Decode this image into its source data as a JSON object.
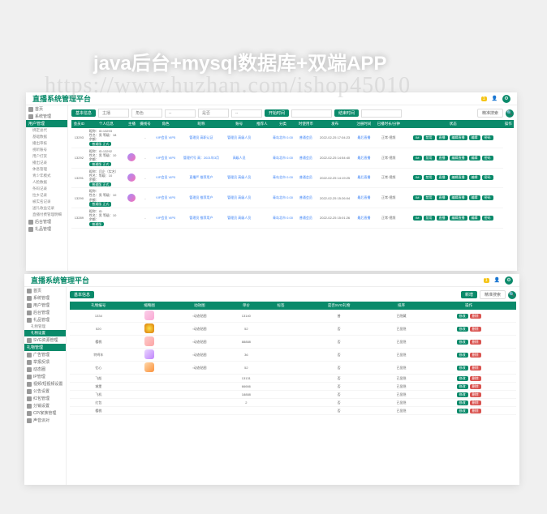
{
  "watermark": {
    "title": "java后台+mysql数据库+双端APP",
    "url": "https://www.huzhan.com/ishop45010"
  },
  "panel1": {
    "title": "直播系统管理平台",
    "badge": "1",
    "sidebar_top": [
      {
        "label": "首页",
        "icon": "⊞"
      },
      {
        "label": "系统管理",
        "icon": "⚙"
      }
    ],
    "sidebar_active": "用户管理",
    "sidebar_sub": [
      "绑定总代",
      "基础数据",
      "播出审核",
      "视听账号",
      "用户打赏",
      "播出记录",
      "休息管理",
      "青少年模式",
      "人脸数据",
      "条码记录",
      "拉乡记录",
      "被实名记录",
      "送礼收益记录",
      "直播付费管理明细"
    ],
    "sidebar_bottom": [
      {
        "label": "后台管理",
        "icon": "☰"
      },
      {
        "label": "礼品管理",
        "icon": "⚑"
      }
    ],
    "filters": {
      "basic_info": "基本信息",
      "level": "主播",
      "select_opts": [
        "角色",
        "--",
        "是否",
        "--"
      ],
      "start_label": "开始时间",
      "end_label": "结束时间",
      "clear": "精准搜索",
      "search": "搜索"
    },
    "columns": [
      "会员ID",
      "个人信息",
      "主播",
      "摄线号",
      "角色",
      "昵称",
      "账号",
      "推荐人",
      "分类",
      "时使用币",
      "发布",
      "注册时间",
      "已播时长/分钟",
      "状态",
      "操作"
    ],
    "rows": [
      {
        "id": "13293",
        "info": "昵称：ID:13293\n性名：男  等级：18\n余额：",
        "anchor_tag": "普通版 正式",
        "avatar": false,
        "role": "-",
        "nick": "VIP会员 VIP5",
        "acc": "管理员 高职认证",
        "rec": "管理员 高级人员",
        "cat": "",
        "coin": "青岛北市 0.00",
        "coin2": "普通会员",
        "time": "2022-02-25 17:04:23",
        "dur": "最后直播",
        "status": "正常·视频",
        "actions": [
          "IM",
          "禁用",
          "直播",
          "编辑直播",
          "编辑",
          "密码"
        ]
      },
      {
        "id": "13292",
        "info": "昵称：ID:13292\n性名：男  等级：10\n余额：",
        "anchor_tag": "普通版 正式",
        "avatar": true,
        "role": "-",
        "nick": "VIP会员 VIP0",
        "acc": "管理代号  \n高：2021年3月",
        "rec": "高级人员",
        "cat": "",
        "coin": "青岛北市 0.00",
        "coin2": "普通会员",
        "time": "2022-02-25 14:54:40",
        "dur": "最后直播",
        "status": "正常·视频",
        "actions": [
          "IM",
          "禁用",
          "直播",
          "编辑直播",
          "编辑",
          "密码"
        ]
      },
      {
        "id": "13291",
        "info": "昵称：闫企（实名）\n性名：等级：10\n余额：",
        "anchor_tag": "普通版 正式",
        "avatar": true,
        "role": "-",
        "nick": "VIP会员 VIP0",
        "acc": "直播严 推荐用户",
        "rec": "管理员 高级人员",
        "cat": "",
        "coin": "青岛北市 0.00",
        "coin2": "普通会员",
        "time": "2022-02-25 14:19:25",
        "dur": "最后直播",
        "status": "正常·视频",
        "actions": [
          "IM",
          "禁用",
          "直播",
          "编辑直播",
          "编辑",
          "密码"
        ]
      },
      {
        "id": "13290",
        "info": "昵称：\n性名：男  等级：10\n余额：",
        "anchor_tag": "普通版 正式",
        "avatar": true,
        "role": "-",
        "nick": "VIP会员 VIP0",
        "acc": "管理员 推荐用户",
        "rec": "管理员 高级人员",
        "cat": "",
        "coin": "青岛北市 0.00",
        "coin2": "普通会员",
        "time": "2022-02-25 15:26:04",
        "dur": "最后直播",
        "status": "正常·视频",
        "actions": [
          "IM",
          "禁用",
          "直播",
          "编辑直播",
          "编辑",
          "密码"
        ]
      },
      {
        "id": "13289",
        "info": "昵称：ID\n性名：男  等级：10\n余额：",
        "anchor_tag": "普通版",
        "avatar": false,
        "role": "-",
        "nick": "VIP会员 VIP0",
        "acc": "管理员 推荐用户",
        "rec": "管理员 高级人员",
        "cat": "",
        "coin": "青岛北市 0.00",
        "coin2": "普通会员",
        "time": "2022-02-25 15:01:26",
        "dur": "最后直播",
        "status": "正常·视频",
        "actions": [
          "IM",
          "禁用",
          "直播",
          "编辑直播",
          "编辑",
          "密码"
        ]
      }
    ]
  },
  "panel2": {
    "title": "直播系统管理平台",
    "badge": "1",
    "sidebar": [
      {
        "label": "首页",
        "icon": "⊞"
      },
      {
        "label": "系统管理",
        "icon": "⚙"
      },
      {
        "label": "用户管理",
        "icon": "☰"
      },
      {
        "label": "后台管理",
        "icon": "⚑"
      },
      {
        "label": "礼品管理",
        "icon": "✦",
        "expand": true
      }
    ],
    "sidebar_sub_active": "礼物设置",
    "sidebar_sub": [
      "礼物管理"
    ],
    "sidebar_after": [
      {
        "label": "SVG资源管理",
        "icon": "◈"
      }
    ],
    "sidebar_active_section": "礼物管理",
    "sidebar_bottom": [
      {
        "label": "广告管理",
        "icon": "▭"
      },
      {
        "label": "举报反馈",
        "icon": "⚠"
      },
      {
        "label": "动态圈",
        "icon": "○"
      },
      {
        "label": "IP管理",
        "icon": "⊡"
      },
      {
        "label": "视频/短视频设置",
        "icon": "▷"
      },
      {
        "label": "公告设置",
        "icon": "✉"
      },
      {
        "label": "红包管理",
        "icon": "✉"
      },
      {
        "label": "分销设置",
        "icon": "$"
      },
      {
        "label": "CP/家族管理",
        "icon": "♥"
      },
      {
        "label": "声音派对",
        "icon": "♪"
      }
    ],
    "filters": {
      "basic_info": "基本信息",
      "add": "新增",
      "clear": "精准搜索",
      "search": "搜索"
    },
    "columns": [
      "礼物编号",
      "缩略图",
      "动效图",
      "单价",
      "标签",
      "是否SVG礼物",
      "排序",
      "操作"
    ],
    "rows": [
      {
        "id": "1334",
        "gift": "g1",
        "anim": "动态贴图",
        "price": "13140",
        "tag": "",
        "svg": "普",
        "sort": "已隐藏",
        "actions": [
          "修改",
          "删除"
        ]
      },
      {
        "id": "520",
        "gift": "g2",
        "anim": "动态贴图",
        "price": "52",
        "tag": "",
        "svg": "否",
        "sort": "已显隐",
        "actions": [
          "修改",
          "删除"
        ]
      },
      {
        "id": "樱桃",
        "gift": "g3",
        "anim": "动态贴图",
        "price": "88888",
        "tag": "",
        "svg": "否",
        "sort": "已显隐",
        "actions": [
          "修改",
          "删除"
        ]
      },
      {
        "id": "特鸡车",
        "gift": "g4",
        "anim": "动态贴图",
        "price": "36",
        "tag": "",
        "svg": "否",
        "sort": "已显隐",
        "actions": [
          "修改",
          "删除"
        ]
      },
      {
        "id": "忆心",
        "gift": "g5",
        "anim": "动态贴图",
        "price": "52",
        "tag": "",
        "svg": "否",
        "sort": "已显隐",
        "actions": [
          "修改",
          "删除"
        ]
      },
      {
        "id": "飞船",
        "gift": "",
        "anim": "",
        "price": "13131",
        "tag": "",
        "svg": "否",
        "sort": "已显隐",
        "actions": [
          "修改",
          "删除"
        ]
      },
      {
        "id": "城堡",
        "gift": "",
        "anim": "",
        "price": "66666",
        "tag": "",
        "svg": "否",
        "sort": "已显隐",
        "actions": [
          "修改",
          "删除"
        ]
      },
      {
        "id": "飞机",
        "gift": "",
        "anim": "",
        "price": "18888",
        "tag": "",
        "svg": "否",
        "sort": "已显隐",
        "actions": [
          "修改",
          "删除"
        ]
      },
      {
        "id": "红包",
        "gift": "",
        "anim": "",
        "price": "2",
        "tag": "",
        "svg": "否",
        "sort": "已显隐",
        "actions": [
          "修改",
          "删除"
        ]
      },
      {
        "id": "樱桃",
        "gift": "",
        "anim": "",
        "price": "",
        "tag": "",
        "svg": "否",
        "sort": "已显隐",
        "actions": [
          "修改",
          "删除"
        ]
      }
    ]
  }
}
